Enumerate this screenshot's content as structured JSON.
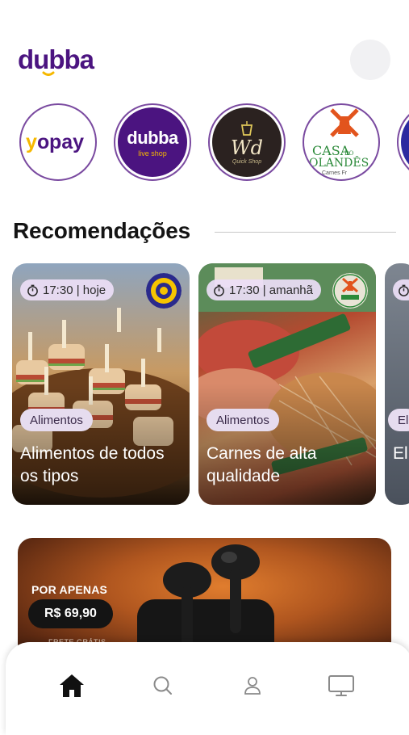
{
  "brand": {
    "name": "dubba",
    "accent": "#4b1480",
    "accent_yellow": "#f6b800"
  },
  "stores": [
    {
      "name": "yopay",
      "icon": "yopay-logo"
    },
    {
      "name": "dubba",
      "subtitle": "live shop",
      "icon": "dubba-logo"
    },
    {
      "name": "Wd",
      "subtitle": "Quick Shop",
      "icon": "wd-logo"
    },
    {
      "name": "CASA DO OLANDÊS",
      "subtitle": "Carnes Fr...",
      "icon": "windmill-logo"
    },
    {
      "name": "",
      "icon": "partial-store-logo"
    }
  ],
  "recommendations": {
    "title": "Recomendações",
    "cards": [
      {
        "time": "17:30 | hoje",
        "category": "Alimentos",
        "title": "Alimentos de todos os tipos",
        "store_icon": "target-logo"
      },
      {
        "time": "17:30 | amanhã",
        "category": "Alimentos",
        "title": "Carnes de alta qualidade",
        "store_icon": "windmill-logo"
      },
      {
        "time": "",
        "category": "El",
        "title": "El... m..."
      }
    ]
  },
  "promo": {
    "label": "POR APENAS",
    "price": "R$ 69,90",
    "note": "FRETE GRÁTIS"
  },
  "nav": [
    {
      "name": "home",
      "icon": "home-icon",
      "active": true
    },
    {
      "name": "search",
      "icon": "search-icon",
      "active": false
    },
    {
      "name": "profile",
      "icon": "user-icon",
      "active": false
    },
    {
      "name": "live",
      "icon": "monitor-icon",
      "active": false
    }
  ]
}
